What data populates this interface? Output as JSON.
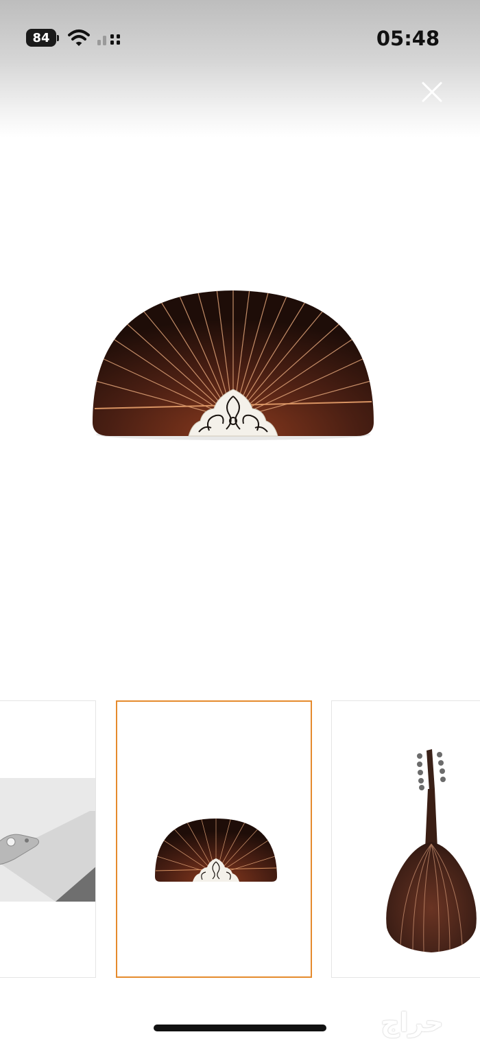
{
  "status_bar": {
    "battery_level": "84",
    "time": "05:48"
  },
  "viewer": {
    "selected_thumbnail_index": 1,
    "thumbnail_count_visible": 3,
    "selected_border_color": "#e58a2c"
  },
  "watermark": {
    "text": "حراج"
  },
  "icons": {
    "close": "close-icon",
    "wifi": "wifi-icon",
    "cellular": "cellular-signal-icon",
    "battery": "battery-icon"
  }
}
